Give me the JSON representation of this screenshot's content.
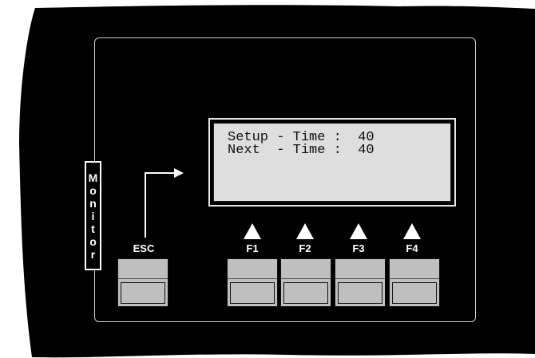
{
  "display": {
    "line1": "Setup - Time :  40",
    "line2": "Next  - Time :  40"
  },
  "monitor_tab": {
    "letters": [
      "M",
      "o",
      "n",
      "i",
      "t",
      "o",
      "r"
    ]
  },
  "keys": {
    "esc": "ESC",
    "f1": "F1",
    "f2": "F2",
    "f3": "F3",
    "f4": "F4"
  },
  "colors": {
    "panel": "#000000",
    "lcd_background": "#dedede",
    "key_face": "#bfbfbf",
    "label_text": "#ffffff"
  }
}
